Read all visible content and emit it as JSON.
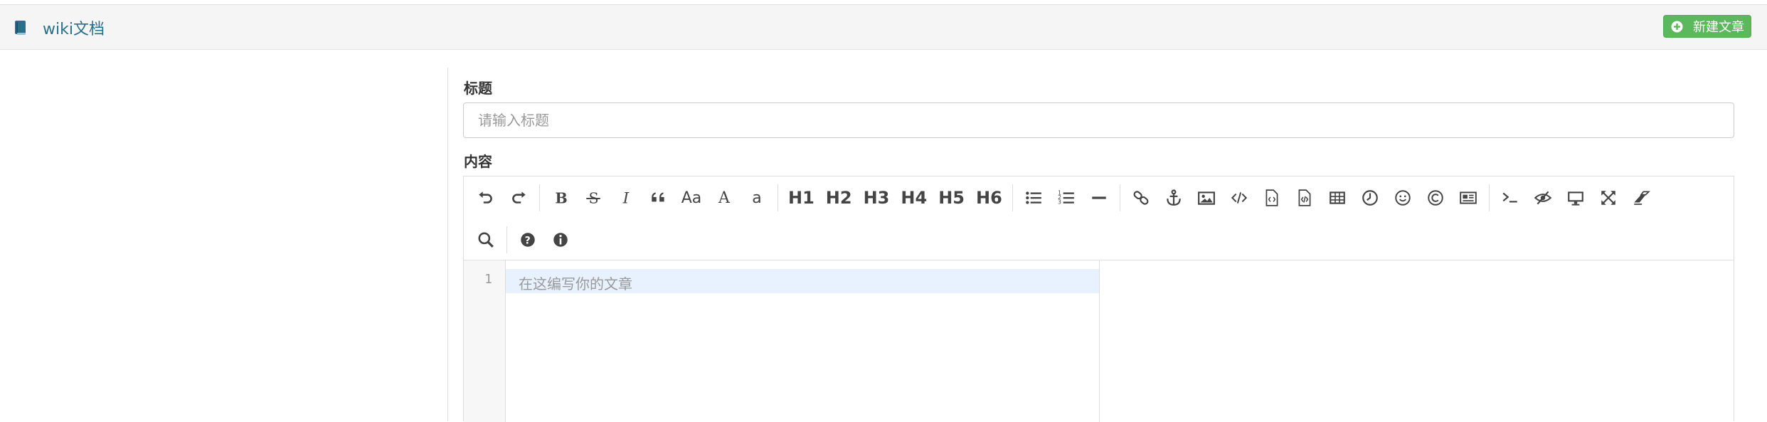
{
  "header": {
    "title": "wiki文档",
    "new_article_label": "新建文章",
    "brand_icon": "book-icon",
    "new_icon": "plus-circle-icon",
    "accent_color": "#5cb85c",
    "title_color": "#2a6f8a"
  },
  "form": {
    "title_label": "标题",
    "title_placeholder": "请输入标题",
    "title_value": "",
    "content_label": "内容"
  },
  "editor": {
    "toolbar_row1": [
      "undo",
      "redo",
      "|",
      "bold",
      "strikethrough",
      "italic",
      "quote",
      "uppercase",
      "ucfirst",
      "lowercase",
      "|",
      "H1",
      "H2",
      "H3",
      "H4",
      "H5",
      "H6",
      "|",
      "list-ul",
      "list-ol",
      "hr",
      "|",
      "link",
      "reference-link",
      "image",
      "code",
      "preformatted-text",
      "code-block",
      "table",
      "datetime",
      "emoji",
      "html-entities",
      "pagebreak",
      "|",
      "goto-line",
      "watch",
      "preview",
      "fullscreen",
      "clear"
    ],
    "toolbar_row2": [
      "search",
      "|",
      "help",
      "info"
    ],
    "case_labels": {
      "uppercase": "Aa",
      "ucfirst": "A",
      "lowercase": "a"
    },
    "headings": {
      "H1": "H1",
      "H2": "H2",
      "H3": "H3",
      "H4": "H4",
      "H5": "H5",
      "H6": "H6"
    },
    "line_number": "1",
    "content_placeholder": "在这编写你的文章"
  }
}
